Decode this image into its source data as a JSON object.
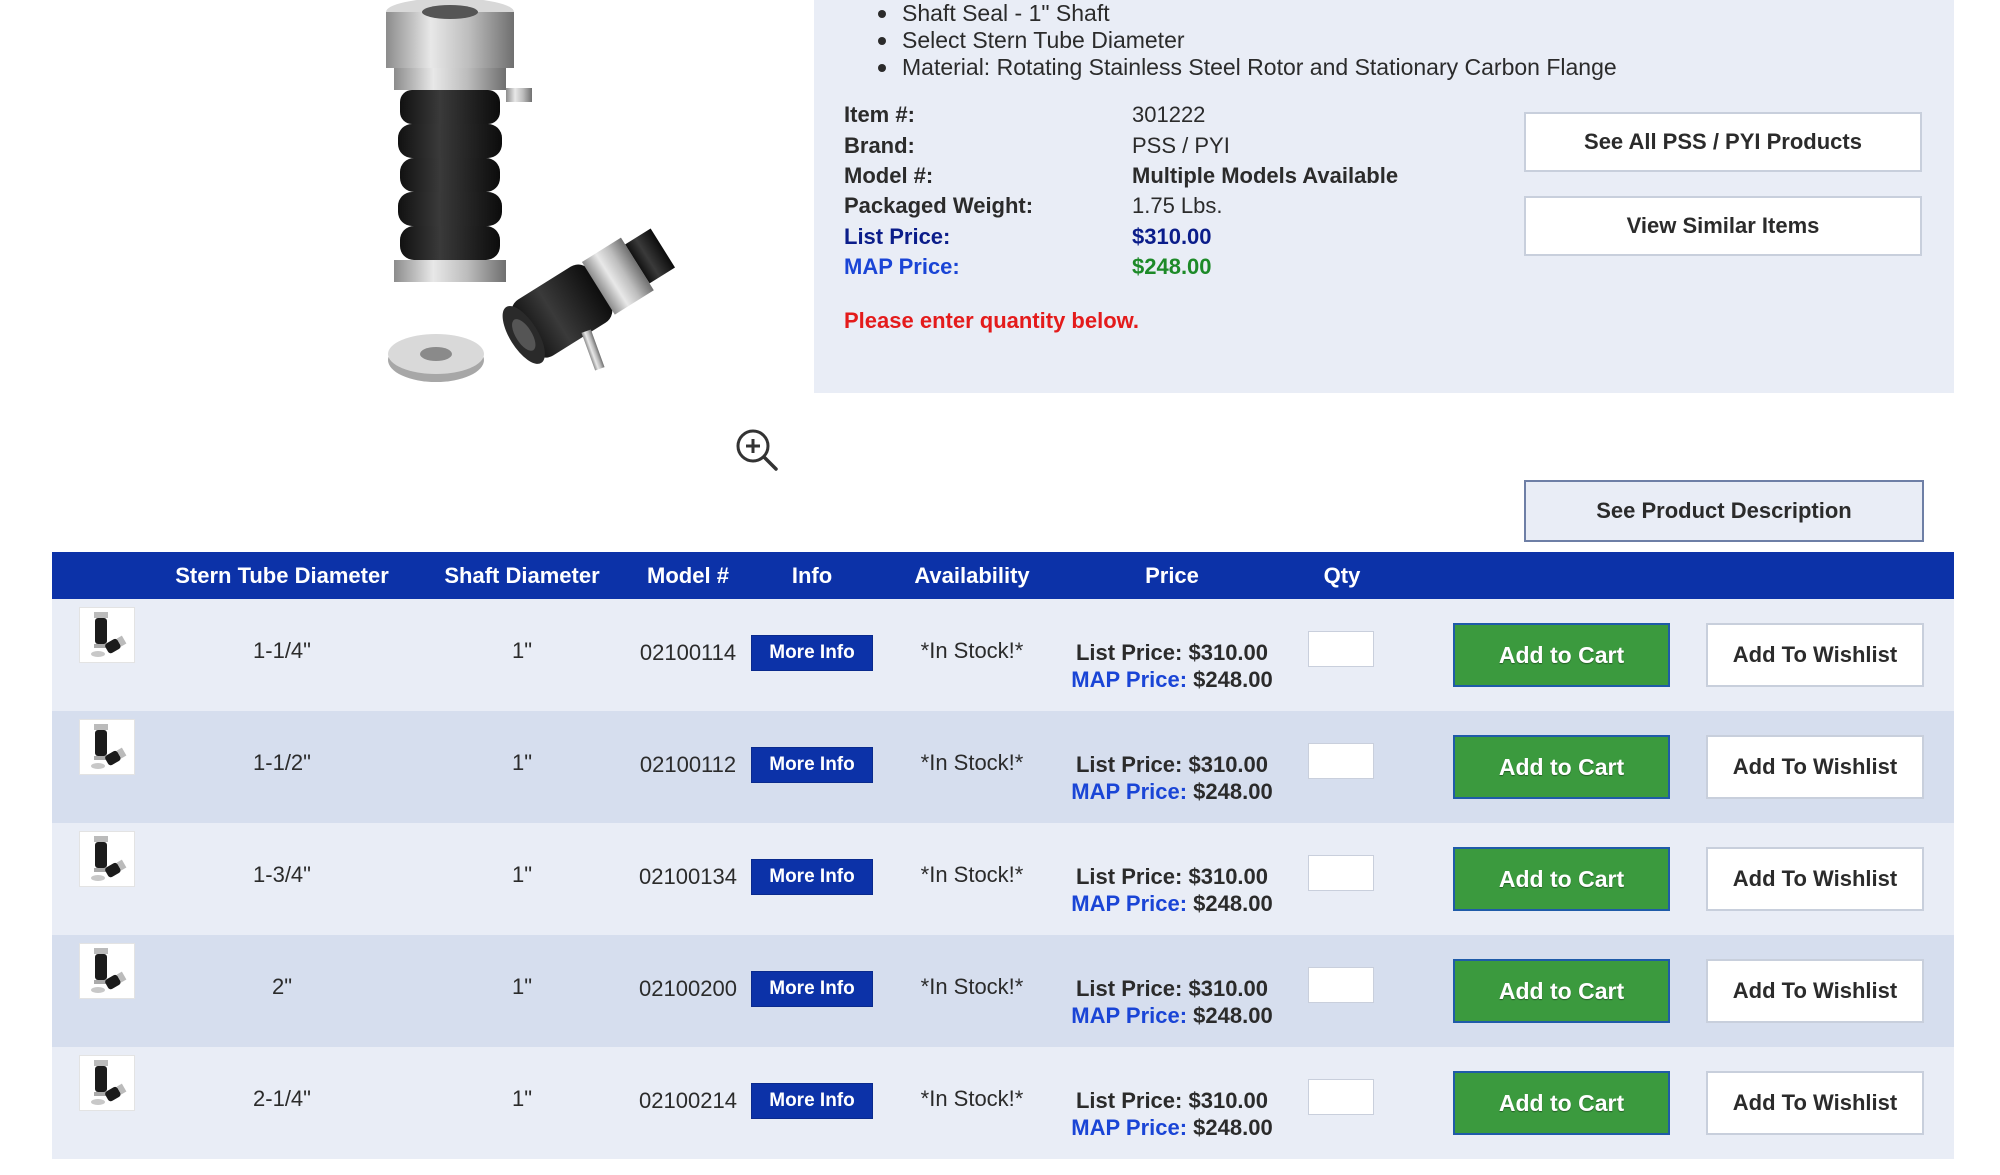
{
  "product": {
    "bullets": [
      "Shaft Seal - 1\" Shaft",
      "Select Stern Tube Diameter",
      "Material: Rotating Stainless Steel Rotor and Stationary Carbon Flange"
    ],
    "specs": {
      "item_label": "Item #:",
      "item_value": "301222",
      "brand_label": "Brand:",
      "brand_value": "PSS / PYI",
      "model_label": "Model #:",
      "model_value": "Multiple Models Available",
      "weight_label": "Packaged Weight:",
      "weight_value": "1.75 Lbs.",
      "list_label": "List Price:",
      "list_value": "$310.00",
      "map_label": "MAP Price:",
      "map_value": "$248.00"
    },
    "qty_note": "Please enter quantity below.",
    "see_all_label": "See All PSS / PYI Products",
    "similar_label": "View Similar Items",
    "description_label": "See Product Description"
  },
  "table": {
    "headers": {
      "stern": "Stern Tube Diameter",
      "shaft": "Shaft Diameter",
      "model": "Model #",
      "info": "Info",
      "availability": "Availability",
      "price": "Price",
      "qty": "Qty"
    },
    "rows": [
      {
        "stern": "1-1/4\"",
        "shaft": "1\"",
        "model": "02100114",
        "info": "More Info",
        "availability": "*In Stock!*",
        "list_label": "List Price:",
        "list": "$310.00",
        "map_label": "MAP Price:",
        "map": "$248.00",
        "qty": "",
        "cart": "Add to Cart",
        "wish": "Add To Wishlist"
      },
      {
        "stern": "1-1/2\"",
        "shaft": "1\"",
        "model": "02100112",
        "info": "More Info",
        "availability": "*In Stock!*",
        "list_label": "List Price:",
        "list": "$310.00",
        "map_label": "MAP Price:",
        "map": "$248.00",
        "qty": "",
        "cart": "Add to Cart",
        "wish": "Add To Wishlist"
      },
      {
        "stern": "1-3/4\"",
        "shaft": "1\"",
        "model": "02100134",
        "info": "More Info",
        "availability": "*In Stock!*",
        "list_label": "List Price:",
        "list": "$310.00",
        "map_label": "MAP Price:",
        "map": "$248.00",
        "qty": "",
        "cart": "Add to Cart",
        "wish": "Add To Wishlist"
      },
      {
        "stern": "2\"",
        "shaft": "1\"",
        "model": "02100200",
        "info": "More Info",
        "availability": "*In Stock!*",
        "list_label": "List Price:",
        "list": "$310.00",
        "map_label": "MAP Price:",
        "map": "$248.00",
        "qty": "",
        "cart": "Add to Cart",
        "wish": "Add To Wishlist"
      },
      {
        "stern": "2-1/4\"",
        "shaft": "1\"",
        "model": "02100214",
        "info": "More Info",
        "availability": "*In Stock!*",
        "list_label": "List Price:",
        "list": "$310.00",
        "map_label": "MAP Price:",
        "map": "$248.00",
        "qty": "",
        "cart": "Add to Cart",
        "wish": "Add To Wishlist"
      }
    ]
  },
  "colors": {
    "header_bg": "#0c32a8",
    "panel_bg": "#e9edf6",
    "cart_green": "#3b9a3e",
    "alert_red": "#e41b1b",
    "map_blue": "#1a45d6",
    "list_navy": "#0b1d8a",
    "map_green": "#1d8a28"
  },
  "icons": {
    "zoom": "zoom-in-icon",
    "product_image": "shaft-seal-product-image",
    "thumbnail": "shaft-seal-thumbnail-icon"
  }
}
